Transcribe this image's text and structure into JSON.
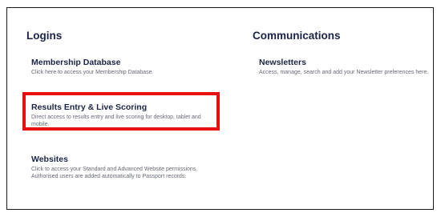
{
  "logins": {
    "heading": "Logins",
    "items": [
      {
        "title": "Membership Database",
        "description": "Click here to access your Membership Database."
      },
      {
        "title": "Results Entry & Live Scoring",
        "description": "Direct access to results entry and live scoring for desktop, tablet and mobile."
      },
      {
        "title": "Websites",
        "description": "Click to access your Standard and Advanced Website permissions. Authorised users are added automatically to Passport records."
      }
    ]
  },
  "communications": {
    "heading": "Communications",
    "items": [
      {
        "title": "Newsletters",
        "description": "Access, manage, search and add your Newsletter preferences here."
      }
    ]
  },
  "highlight_color": "#e8100c"
}
